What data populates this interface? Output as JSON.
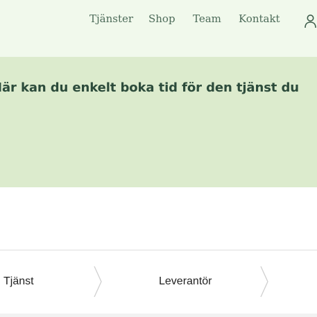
{
  "nav": {
    "items": [
      {
        "label": "Tjänster"
      },
      {
        "label": "Shop"
      },
      {
        "label": "Team"
      },
      {
        "label": "Kontakt"
      }
    ],
    "user_icon": "user-icon"
  },
  "hero": {
    "text": "Här kan du enkelt boka tid för den tjänst du"
  },
  "steps": {
    "items": [
      {
        "label": "Tjänst"
      },
      {
        "label": "Leverantör"
      }
    ],
    "separator_icon": "chevron-right-icon"
  },
  "colors": {
    "topbar_bg": "#f1f9ec",
    "hero_bg": "#dcebcd",
    "hero_text": "#2c4b3b",
    "nav_text": "#4d6b59"
  }
}
